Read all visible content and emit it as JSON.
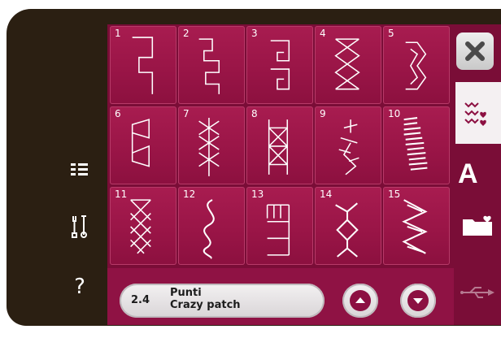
{
  "left_menu": {
    "items": [
      {
        "name": "list-icon"
      },
      {
        "name": "tools-icon"
      },
      {
        "name": "help-icon",
        "glyph": "?"
      }
    ]
  },
  "stitches": [
    {
      "number": "1",
      "icon": "greek-key-stitch-icon"
    },
    {
      "number": "2",
      "icon": "greek-key-double-stitch-icon"
    },
    {
      "number": "3",
      "icon": "spiral-key-stitch-icon"
    },
    {
      "number": "4",
      "icon": "crossed-zigzag-stitch-icon"
    },
    {
      "number": "5",
      "icon": "chevron-band-stitch-icon"
    },
    {
      "number": "6",
      "icon": "triangle-ladder-stitch-icon"
    },
    {
      "number": "7",
      "icon": "feather-cross-stitch-icon"
    },
    {
      "number": "8",
      "icon": "lattice-bar-stitch-icon"
    },
    {
      "number": "9",
      "icon": "vine-leaf-stitch-icon"
    },
    {
      "number": "10",
      "icon": "slanted-satin-stitch-icon"
    },
    {
      "number": "11",
      "icon": "diamond-mesh-stitch-icon"
    },
    {
      "number": "12",
      "icon": "serpentine-stitch-icon"
    },
    {
      "number": "13",
      "icon": "blanket-stitch-icon"
    },
    {
      "number": "14",
      "icon": "arrow-band-stitch-icon"
    },
    {
      "number": "15",
      "icon": "zigzag-stitch-icon"
    }
  ],
  "selection": {
    "code": "2.4",
    "line1": "Punti",
    "line2": "Crazy patch"
  },
  "right_panel": {
    "tabs": [
      {
        "name": "stitch-menu-tab"
      },
      {
        "name": "font-tab",
        "glyph": "A"
      },
      {
        "name": "folder-tab"
      }
    ]
  },
  "colors": {
    "bezel": "#2b1f12",
    "panel": "#7a0d37",
    "cell": "#9a1547",
    "accent_button": "#8c1042"
  }
}
